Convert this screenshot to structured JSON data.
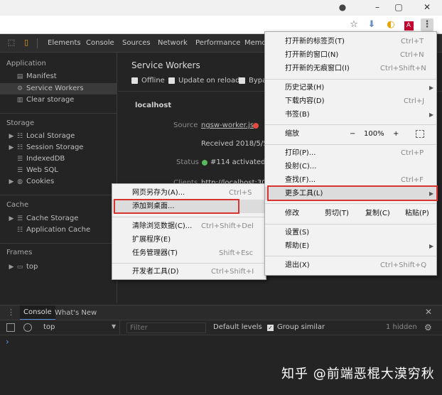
{
  "window": {
    "controls": [
      "–",
      "▢",
      "✕"
    ]
  },
  "devtools": {
    "tabs": [
      "Elements",
      "Console",
      "Sources",
      "Network",
      "Performance",
      "Memo"
    ]
  },
  "sidebar": {
    "application_title": "Application",
    "application_items": [
      "Manifest",
      "Service Workers",
      "Clear storage"
    ],
    "storage_title": "Storage",
    "storage_items": [
      "Local Storage",
      "Session Storage",
      "IndexedDB",
      "Web SQL",
      "Cookies"
    ],
    "cache_title": "Cache",
    "cache_items": [
      "Cache Storage",
      "Application Cache"
    ],
    "frames_title": "Frames",
    "frames_items": [
      "top"
    ]
  },
  "main": {
    "title": "Service Workers",
    "offline_label": "Offline",
    "update_on_reload_label": "Update on reload",
    "bypass_label": "Bypa",
    "host": "localhost",
    "source_label": "Source",
    "source_file": "ngsw-worker.js",
    "received": "Received 2018/5/5 上",
    "status_label": "Status",
    "status_value": "#114 activated an",
    "clients_label": "Clients",
    "clients_value": "http://localhost:3000"
  },
  "chrome_menu": {
    "items": [
      {
        "label": "打开新的标签页(T)",
        "shortcut": "Ctrl+T"
      },
      {
        "label": "打开新的窗口(N)",
        "shortcut": "Ctrl+N"
      },
      {
        "label": "打开新的无痕窗口(I)",
        "shortcut": "Ctrl+Shift+N"
      },
      {
        "label": "历史记录(H)",
        "shortcut": ""
      },
      {
        "label": "下载内容(D)",
        "shortcut": "Ctrl+J"
      },
      {
        "label": "书签(B)",
        "shortcut": ""
      },
      {
        "label": "缩放",
        "shortcut": ""
      },
      {
        "label": "打印(P)...",
        "shortcut": "Ctrl+P"
      },
      {
        "label": "投射(C)...",
        "shortcut": ""
      },
      {
        "label": "查找(F)...",
        "shortcut": "Ctrl+F"
      },
      {
        "label": "更多工具(L)",
        "shortcut": ""
      },
      {
        "label": "修改",
        "shortcut": ""
      },
      {
        "label": "设置(S)",
        "shortcut": ""
      },
      {
        "label": "帮助(E)",
        "shortcut": ""
      },
      {
        "label": "退出(X)",
        "shortcut": "Ctrl+Shift+Q"
      }
    ],
    "zoom_minus": "−",
    "zoom_value": "100%",
    "zoom_plus": "+",
    "edit_cut": "剪切(T)",
    "edit_copy": "复制(C)",
    "edit_paste": "粘贴(P)"
  },
  "more_tools_menu": {
    "items": [
      {
        "label": "网页另存为(A)...",
        "shortcut": "Ctrl+S"
      },
      {
        "label": "添加到桌面...",
        "shortcut": ""
      },
      {
        "label": "清除浏览数据(C)...",
        "shortcut": "Ctrl+Shift+Del"
      },
      {
        "label": "扩展程序(E)",
        "shortcut": ""
      },
      {
        "label": "任务管理器(T)",
        "shortcut": "Shift+Esc"
      },
      {
        "label": "开发者工具(D)",
        "shortcut": "Ctrl+Shift+I"
      }
    ]
  },
  "drawer": {
    "tabs": [
      "Console",
      "What's New"
    ],
    "context": "top",
    "filter_placeholder": "Filter",
    "levels": "Default levels",
    "group_similar": "Group similar",
    "hidden_count": "1 hidden",
    "prompt": "›"
  },
  "watermark": "知乎 @前端恶棍大漠穷秋",
  "colors": {
    "highlight_box": "#d8342f",
    "menu_bg": "#f2f2f2",
    "devtools_bg": "#242424"
  }
}
